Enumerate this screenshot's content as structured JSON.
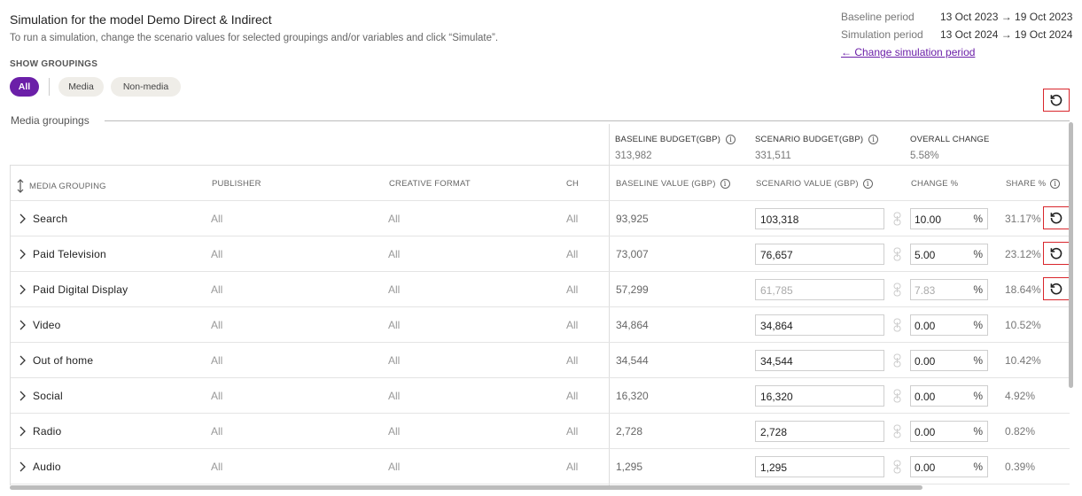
{
  "header": {
    "title": "Simulation for the model Demo Direct & Indirect",
    "subtitle": "To run a simulation, change the scenario values for selected groupings and/or variables and click “Simulate”.",
    "show_groupings_label": "SHOW GROUPINGS",
    "chips": [
      {
        "label": "All",
        "active": true
      },
      {
        "label": "Media",
        "active": false
      },
      {
        "label": "Non-media",
        "active": false
      }
    ]
  },
  "periods": {
    "baseline_label": "Baseline period",
    "baseline_value": "13 Oct 2023 → 19 Oct 2023",
    "simulation_label": "Simulation period",
    "simulation_value": "13 Oct 2024 → 19 Oct 2024",
    "change_link": "← Change simulation period"
  },
  "section_label": "Media groupings",
  "budget": {
    "baseline_label": "BASELINE BUDGET(GBP)",
    "baseline_value": "313,982",
    "scenario_label": "SCENARIO BUDGET(GBP)",
    "scenario_value": "331,511",
    "overall_label": "OVERALL CHANGE",
    "overall_value": "5.58%"
  },
  "columns": {
    "media_grouping": "MEDIA GROUPING",
    "publisher": "PUBLISHER",
    "creative_format": "CREATIVE FORMAT",
    "ch": "CH",
    "baseline_value": "BASELINE VALUE (GBP)",
    "scenario_value": "SCENARIO VALUE (GBP)",
    "change_pct": "CHANGE %",
    "share_pct": "SHARE %"
  },
  "rows": [
    {
      "name": "Search",
      "publisher": "All",
      "format": "All",
      "ch": "All",
      "baseline": "93,925",
      "scenario": "103,318",
      "change": "10.00",
      "pct": "%",
      "share": "31.17%"
    },
    {
      "name": "Paid Television",
      "publisher": "All",
      "format": "All",
      "ch": "All",
      "baseline": "73,007",
      "scenario": "76,657",
      "change": "5.00",
      "pct": "%",
      "share": "23.12%"
    },
    {
      "name": "Paid Digital Display",
      "publisher": "All",
      "format": "All",
      "ch": "All",
      "baseline": "57,299",
      "scenario": "61,785",
      "change": "7.83",
      "pct": "%",
      "share": "18.64%"
    },
    {
      "name": "Video",
      "publisher": "All",
      "format": "All",
      "ch": "All",
      "baseline": "34,864",
      "scenario": "34,864",
      "change": "0.00",
      "pct": "%",
      "share": "10.52%"
    },
    {
      "name": "Out of home",
      "publisher": "All",
      "format": "All",
      "ch": "All",
      "baseline": "34,544",
      "scenario": "34,544",
      "change": "0.00",
      "pct": "%",
      "share": "10.42%"
    },
    {
      "name": "Social",
      "publisher": "All",
      "format": "All",
      "ch": "All",
      "baseline": "16,320",
      "scenario": "16,320",
      "change": "0.00",
      "pct": "%",
      "share": "4.92%"
    },
    {
      "name": "Radio",
      "publisher": "All",
      "format": "All",
      "ch": "All",
      "baseline": "2,728",
      "scenario": "2,728",
      "change": "0.00",
      "pct": "%",
      "share": "0.82%"
    },
    {
      "name": "Audio",
      "publisher": "All",
      "format": "All",
      "ch": "All",
      "baseline": "1,295",
      "scenario": "1,295",
      "change": "0.00",
      "pct": "%",
      "share": "0.39%"
    }
  ],
  "colors": {
    "accent": "#6b1fa8",
    "highlight_border": "#d9262c"
  }
}
